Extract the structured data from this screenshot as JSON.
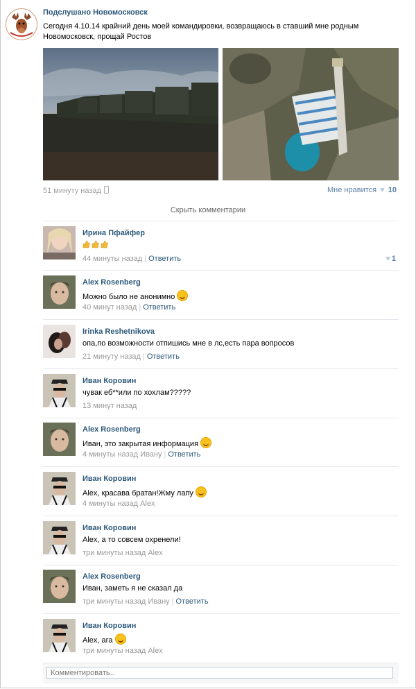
{
  "post": {
    "group_name": "Подслушано Новомосковск",
    "text": "Сегодня 4.10.14 крайний день моей командировки, возвращаюсь в ставший мне родным Новомосковск, прощай Ростов",
    "time": "51 минуту назад",
    "like_label": "Мне нравится",
    "like_count": "10",
    "hide_comments": "Скрыть комментарии"
  },
  "comments": [
    {
      "author": "Ирина Пфайфер",
      "text": "",
      "time": "44 минуты назад",
      "reply": "Ответить",
      "likes": "1"
    },
    {
      "author": "Alex Rosenberg",
      "text": "Можно было не анонимно",
      "time": "40 минут назад",
      "reply": "Ответить"
    },
    {
      "author": "Irinka Reshetnikova",
      "text": "опа,по возможности отпишись мне в лс,есть пара вопросов",
      "time": "21 минуту назад",
      "reply": "Ответить"
    },
    {
      "author": "Иван Коровин",
      "text": "чувак еб**или по хохлам?????",
      "time": "13 минут назад"
    },
    {
      "author": "Alex Rosenberg",
      "text": "Иван, это закрытая информация",
      "time": "4 минуты назад Ивану",
      "reply": "Ответить"
    },
    {
      "author": "Иван Коровин",
      "text": "Alex, красава братан!Жму лапу",
      "time": "4 минуты назад Alex"
    },
    {
      "author": "Иван Коровин",
      "text": "Alex, а то совсем охренели!",
      "time": "три минуты назад Alex"
    },
    {
      "author": "Alex Rosenberg",
      "text": "Иван, заметь я не сказал да",
      "time": "три минуты назад Ивану",
      "reply": "Ответить"
    },
    {
      "author": "Иван Коровин",
      "text": "Alex, ага",
      "time": "три минуты назад Alex"
    }
  ],
  "comment_input": {
    "placeholder": "Комментировать.."
  },
  "icons": {
    "like": "heart-icon",
    "device": "phone-icon",
    "emoji": "smile-icon",
    "thumbs": "thumbs-up-icon"
  },
  "colors": {
    "link": "#2b587a",
    "meta": "#999999",
    "like": "#5b7fa6"
  }
}
